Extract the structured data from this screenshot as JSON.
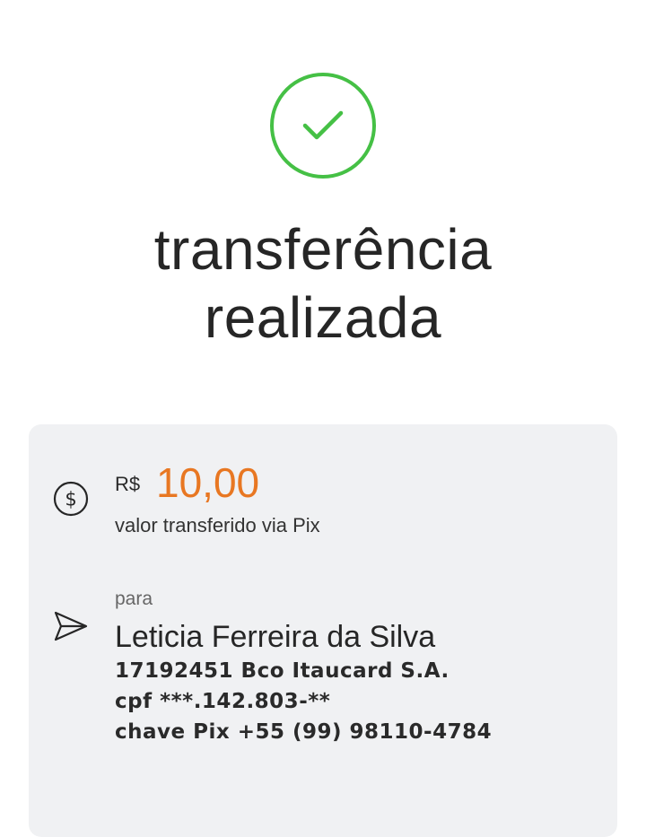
{
  "status": {
    "icon": "check-circle-icon",
    "title_line1": "transferência",
    "title_line2": "realizada",
    "accent_color": "#45c045"
  },
  "transfer": {
    "amount_icon": "dollar-circle-icon",
    "currency": "R$",
    "amount": "10,00",
    "amount_color": "#e87722",
    "caption": "valor transferido via Pix"
  },
  "recipient": {
    "icon": "send-icon",
    "label": "para",
    "name": "Leticia Ferreira da Silva",
    "bank": "17192451 Bco Itaucard S.A.",
    "cpf": "cpf ***.142.803-**",
    "pix_key": "chave Pix +55 (99) 98110-4784"
  }
}
